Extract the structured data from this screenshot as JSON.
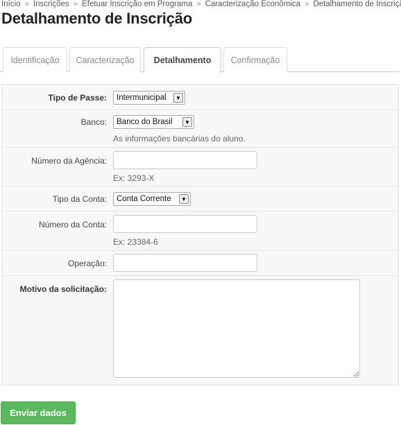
{
  "breadcrumb": {
    "items": [
      "Início",
      "Inscrições",
      "Efetuar Inscrição em Programa",
      "Caracterização Econômica",
      "Detalhamento de Inscrição"
    ],
    "separator": "»"
  },
  "page": {
    "title": "Detalhamento de Inscrição"
  },
  "tabs": [
    {
      "label": "Identificação",
      "active": false
    },
    {
      "label": "Caracterização",
      "active": false
    },
    {
      "label": "Detalhamento",
      "active": true
    },
    {
      "label": "Confirmação",
      "active": false
    }
  ],
  "form": {
    "tipo_passe": {
      "label": "Tipo de Passe:",
      "value": "Intermunicipal"
    },
    "banco": {
      "label": "Banco:",
      "value": "Banco do Brasil",
      "help": "As informações bancárias do aluno."
    },
    "agencia": {
      "label": "Número da Agência:",
      "value": "",
      "help": "Ex: 3293-X"
    },
    "tipo_conta": {
      "label": "Tipo da Conta:",
      "value": "Conta Corrente"
    },
    "numero_conta": {
      "label": "Número da Conta:",
      "value": "",
      "help": "Ex: 23384-6"
    },
    "operacao": {
      "label": "Operação:",
      "value": ""
    },
    "motivo": {
      "label": "Motivo da solicitação:",
      "value": ""
    }
  },
  "actions": {
    "submit_label": "Enviar dados"
  },
  "colors": {
    "submit": "#5cb85c",
    "form_bg": "#f8f8f8"
  }
}
